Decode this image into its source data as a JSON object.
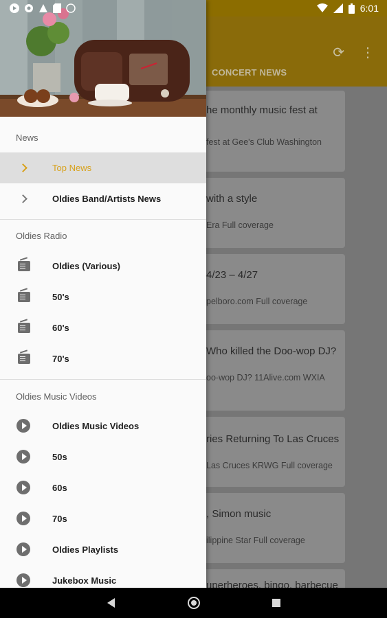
{
  "status_bar": {
    "time": "6:01"
  },
  "app": {
    "tab_label": "CONCERT NEWS",
    "cards": [
      {
        "title": "he monthly music fest at",
        "source": "fest at Gee's Club  Washington"
      },
      {
        "title": "with a style",
        "source": "Era  Full coverage"
      },
      {
        "title": "4/23 – 4/27",
        "source": "pelboro.com  Full coverage"
      },
      {
        "title": "Who killed the Doo-wop DJ?",
        "source": "oo-wop DJ?  11Alive.com WXIA"
      },
      {
        "title": "ries Returning To Las Cruces",
        "source": "Las Cruces  KRWG  Full coverage"
      },
      {
        "title": ", Simon music",
        "source": "ilippine Star  Full coverage"
      },
      {
        "title": "uperheroes, bingo, barbecue",
        "source": ""
      }
    ]
  },
  "drawer": {
    "sections": [
      {
        "title": "News",
        "items": [
          {
            "label": "Top News",
            "icon": "chevron-right-icon",
            "active": true
          },
          {
            "label": "Oldies Band/Artists News",
            "icon": "chevron-right-icon"
          }
        ]
      },
      {
        "title": "Oldies Radio",
        "items": [
          {
            "label": "Oldies (Various)",
            "icon": "radio-icon"
          },
          {
            "label": "50's",
            "icon": "radio-icon"
          },
          {
            "label": "60's",
            "icon": "radio-icon"
          },
          {
            "label": "70's",
            "icon": "radio-icon"
          }
        ]
      },
      {
        "title": "Oldies Music Videos",
        "items": [
          {
            "label": "Oldies Music Videos",
            "icon": "play-circle-icon"
          },
          {
            "label": "50s",
            "icon": "play-circle-icon"
          },
          {
            "label": "60s",
            "icon": "play-circle-icon"
          },
          {
            "label": "70s",
            "icon": "play-circle-icon"
          },
          {
            "label": "Oldies Playlists",
            "icon": "play-circle-icon"
          },
          {
            "label": "Jukebox Music",
            "icon": "play-circle-icon"
          }
        ]
      }
    ]
  },
  "colors": {
    "accent": "#d8a21c",
    "app_bar": "#8a6b0a",
    "drawer_bg": "#fafafa"
  }
}
